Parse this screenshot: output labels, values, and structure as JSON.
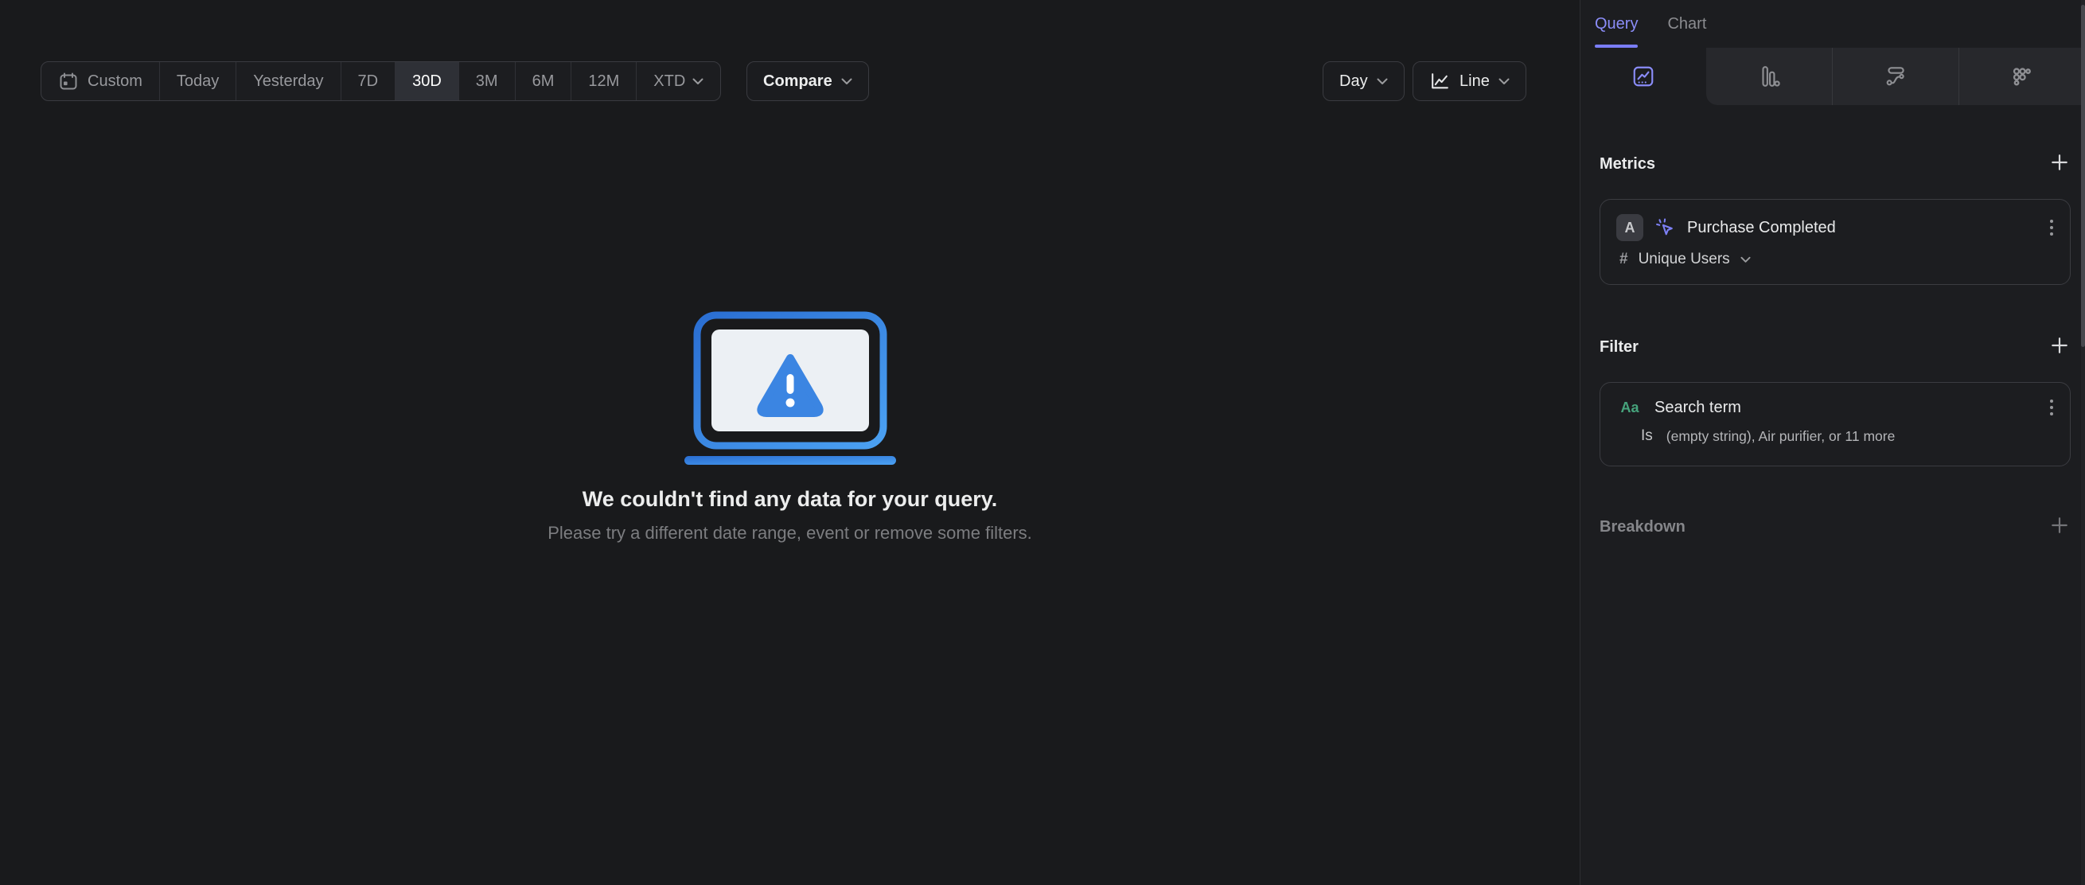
{
  "colors": {
    "accent_purple": "#7a7df6",
    "illustration_blue_dark": "#2a6ed2",
    "illustration_blue_light": "#4ba1f2",
    "filter_green": "#46a37c",
    "page_bg": "#191a1c",
    "panel_bg": "#1c1d20"
  },
  "icons": [
    "calendar-icon",
    "chevron-down-icon",
    "line-chart-icon",
    "insights-icon",
    "funnels-icon",
    "flows-icon",
    "retention-icon",
    "plus-icon",
    "kebab-menu-icon",
    "event-click-icon",
    "warning-laptop-illustration"
  ],
  "toolbar": {
    "date_ranges": [
      "Custom",
      "Today",
      "Yesterday",
      "7D",
      "30D",
      "3M",
      "6M",
      "12M",
      "XTD"
    ],
    "selected_range": "30D",
    "compare": "Compare",
    "granularity": "Day",
    "chart_type": "Line"
  },
  "empty_state": {
    "title": "We couldn't find any data for your query.",
    "subtitle": "Please try a different date range, event or remove some filters."
  },
  "panel": {
    "tabs": {
      "query": "Query",
      "chart": "Chart"
    },
    "view_tabs": [
      "insights",
      "funnels",
      "flows",
      "retention"
    ],
    "active_view_tab": "insights",
    "metrics": {
      "heading": "Metrics",
      "item": {
        "letter": "A",
        "event": "Purchase Completed",
        "aggregation_symbol": "#",
        "aggregation": "Unique Users"
      }
    },
    "filter": {
      "heading": "Filter",
      "item": {
        "type_label": "Aa",
        "property": "Search term",
        "operator": "Is",
        "values": "(empty string), Air purifier, or 11 more"
      }
    },
    "breakdown": {
      "heading": "Breakdown"
    }
  }
}
